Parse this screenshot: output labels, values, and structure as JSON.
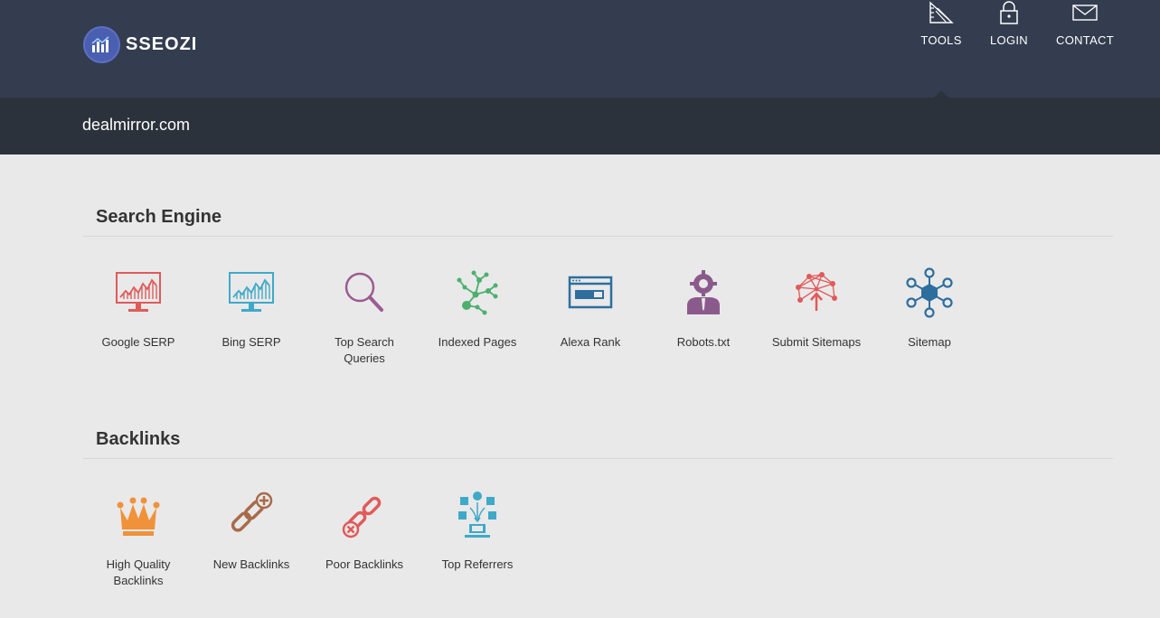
{
  "header": {
    "logo_text": "SSEOZI",
    "nav": [
      {
        "label": "TOOLS",
        "icon": "tools-icon"
      },
      {
        "label": "LOGIN",
        "icon": "lock-icon"
      },
      {
        "label": "CONTACT",
        "icon": "envelope-icon"
      }
    ]
  },
  "domain": {
    "title": "dealmirror.com"
  },
  "sections": [
    {
      "title": "Search Engine",
      "tools": [
        {
          "label": "Google SERP",
          "icon": "monitor-chart-icon",
          "color": "#e05a5a"
        },
        {
          "label": "Bing SERP",
          "icon": "monitor-chart-icon",
          "color": "#3fa9c9"
        },
        {
          "label": "Top Search Queries",
          "icon": "magnifier-icon",
          "color": "#9b5c91"
        },
        {
          "label": "Indexed Pages",
          "icon": "node-tree-icon",
          "color": "#4caf6e"
        },
        {
          "label": "Alexa Rank",
          "icon": "browser-window-icon",
          "color": "#2e6e9e"
        },
        {
          "label": "Robots.txt",
          "icon": "robot-person-icon",
          "color": "#8b5a8c"
        },
        {
          "label": "Submit Sitemaps",
          "icon": "network-upload-icon",
          "color": "#e05a5a"
        },
        {
          "label": "Sitemap",
          "icon": "hub-nodes-icon",
          "color": "#2e6e9e"
        }
      ]
    },
    {
      "title": "Backlinks",
      "tools": [
        {
          "label": "High Quality Backlinks",
          "icon": "crown-icon",
          "color": "#f0923a"
        },
        {
          "label": "New Backlinks",
          "icon": "chain-add-icon",
          "color": "#a86b4a"
        },
        {
          "label": "Poor Backlinks",
          "icon": "chain-broken-icon",
          "color": "#e05a5a"
        },
        {
          "label": "Top Referrers",
          "icon": "social-referrers-icon",
          "color": "#3fa9c9"
        }
      ]
    }
  ]
}
